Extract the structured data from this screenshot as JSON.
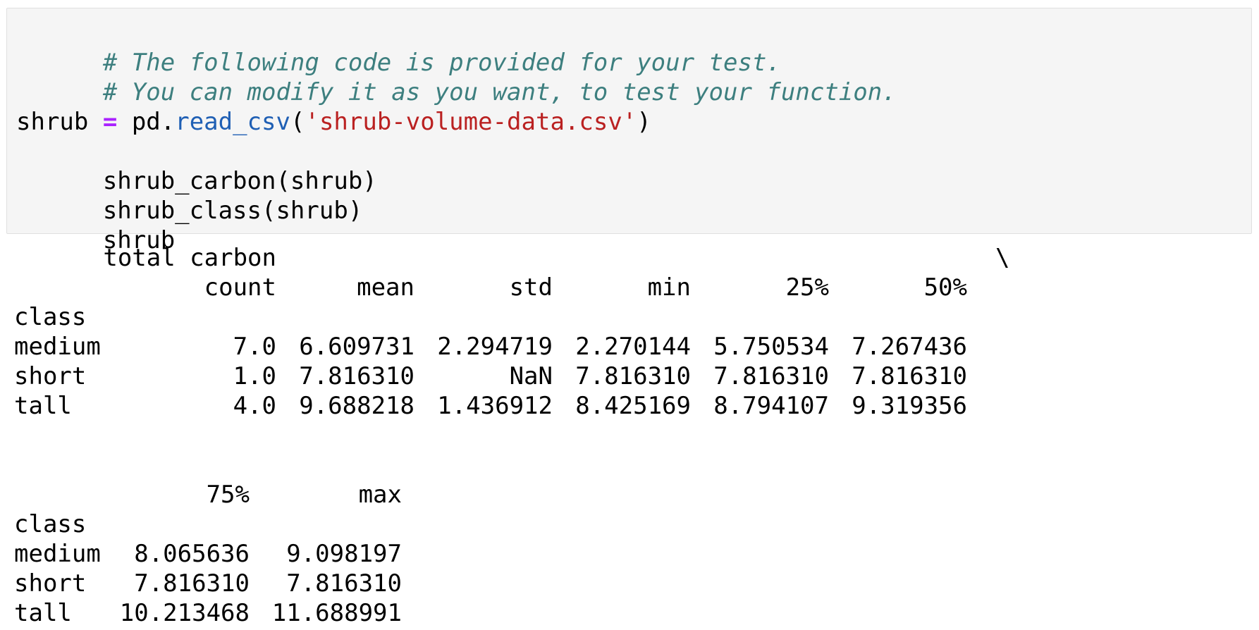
{
  "code": {
    "lines": [
      "# The following code is provided for your test.",
      "# You can modify it as you want, to test your function."
    ],
    "var_shrub": "shrub",
    "op_assign": "=",
    "pd_ref": "pd.",
    "read_csv": "read_csv",
    "open_paren": "(",
    "csv_string": "'shrub-volume-data.csv'",
    "close_paren": ")",
    "call_carbon": "shrub_carbon(shrub)",
    "call_class": "shrub_class(shrub)",
    "final_expr": "shrub"
  },
  "output": {
    "header_top": "total carbon",
    "continuation": "\\",
    "block1_columns": [
      "count",
      "mean",
      "std",
      "min",
      "25%",
      "50%"
    ],
    "index_name": "class",
    "block1_rows": [
      {
        "label": "medium",
        "values": [
          "7.0",
          "6.609731",
          "2.294719",
          "2.270144",
          "5.750534",
          "7.267436"
        ]
      },
      {
        "label": "short",
        "values": [
          "1.0",
          "7.816310",
          "NaN",
          "7.816310",
          "7.816310",
          "7.816310"
        ]
      },
      {
        "label": "tall",
        "values": [
          "4.0",
          "9.688218",
          "1.436912",
          "8.425169",
          "8.794107",
          "9.319356"
        ]
      }
    ],
    "block2_columns": [
      "75%",
      "max"
    ],
    "block2_rows": [
      {
        "label": "medium",
        "values": [
          "8.065636",
          "9.098197"
        ]
      },
      {
        "label": "short",
        "values": [
          "7.816310",
          "7.816310"
        ]
      },
      {
        "label": "tall",
        "values": [
          "10.213468",
          "11.688991"
        ]
      }
    ]
  }
}
